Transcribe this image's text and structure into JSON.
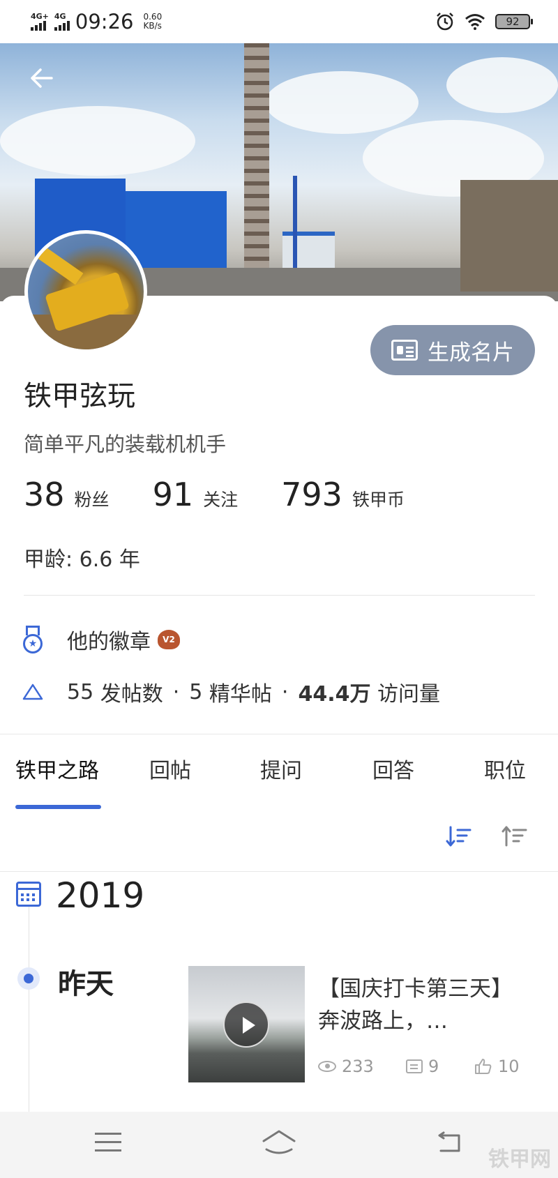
{
  "status_bar": {
    "network_1": "4G+",
    "network_2": "4G",
    "time": "09:26",
    "speed_value": "0.60",
    "speed_unit": "KB/s",
    "battery": "92",
    "icons": [
      "alarm-icon",
      "wifi-icon",
      "battery-icon"
    ]
  },
  "header": {
    "back_icon": "arrow-left-icon"
  },
  "profile": {
    "username": "铁甲弦玩",
    "bio": "简单平凡的装载机机手",
    "card_button_label": "生成名片",
    "stats": [
      {
        "value": "38",
        "label": "粉丝"
      },
      {
        "value": "91",
        "label": "关注"
      },
      {
        "value": "793",
        "label": "铁甲币"
      }
    ],
    "age_text": "甲龄: 6.6 年"
  },
  "badges": {
    "label": "他的徽章",
    "badge_text": "V2"
  },
  "post_stats": {
    "posts_count": "55",
    "posts_label": "发帖数",
    "essence_count": "5",
    "essence_label": "精华帖",
    "visits_count": "44.4万",
    "visits_label": "访问量",
    "separator": "·"
  },
  "tabs": [
    {
      "label": "铁甲之路",
      "active": true
    },
    {
      "label": "回帖",
      "active": false
    },
    {
      "label": "提问",
      "active": false
    },
    {
      "label": "回答",
      "active": false
    },
    {
      "label": "职位",
      "active": false
    }
  ],
  "timeline": {
    "year": "2019",
    "entries": [
      {
        "day": "昨天",
        "title": "【国庆打卡第三天】奔波路上，…",
        "views": "233",
        "comments": "9",
        "likes": "10"
      }
    ]
  },
  "colors": {
    "accent": "#3c68d6",
    "card_button": "#8694ab",
    "muted_text": "#999999"
  },
  "navbar": {
    "watermark": "铁甲网"
  }
}
